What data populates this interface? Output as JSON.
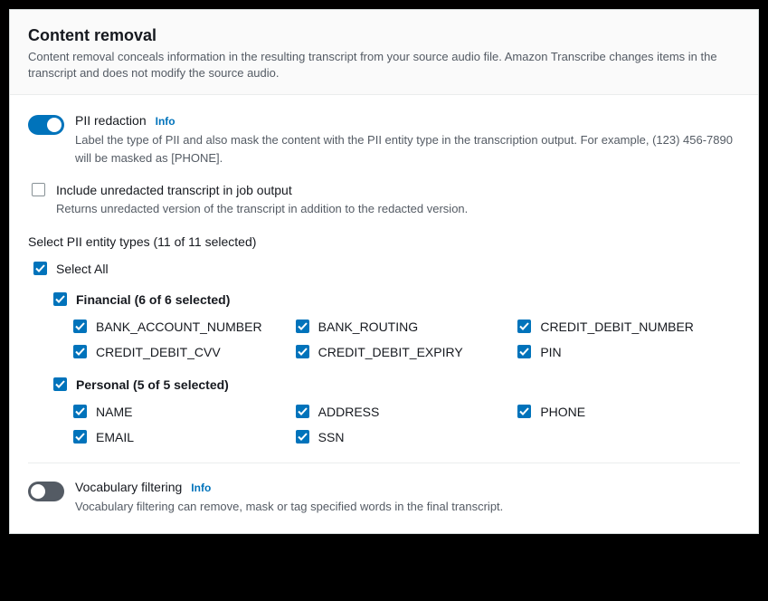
{
  "header": {
    "title": "Content removal",
    "description": "Content removal conceals information in the resulting transcript from your source audio file. Amazon Transcribe changes items in the transcript and does not modify the source audio."
  },
  "pii_redaction": {
    "title": "PII redaction",
    "info": "Info",
    "description": "Label the type of PII and also mask the content with the PII entity type in the transcription output. For example, (123) 456-7890 will be masked as [PHONE]."
  },
  "include_unredacted": {
    "title": "Include unredacted transcript in job output",
    "description": "Returns unredacted version of the transcript in addition to the redacted version."
  },
  "entity_types": {
    "label": "Select PII entity types (11 of 11 selected)",
    "select_all": "Select All",
    "groups": [
      {
        "title": "Financial (6 of 6 selected)",
        "items": [
          "BANK_ACCOUNT_NUMBER",
          "BANK_ROUTING",
          "CREDIT_DEBIT_NUMBER",
          "CREDIT_DEBIT_CVV",
          "CREDIT_DEBIT_EXPIRY",
          "PIN"
        ]
      },
      {
        "title": "Personal (5 of 5 selected)",
        "items": [
          "NAME",
          "ADDRESS",
          "PHONE",
          "EMAIL",
          "SSN"
        ]
      }
    ]
  },
  "vocab_filtering": {
    "title": "Vocabulary filtering",
    "info": "Info",
    "description": "Vocabulary filtering can remove, mask or tag specified words in the final transcript."
  }
}
